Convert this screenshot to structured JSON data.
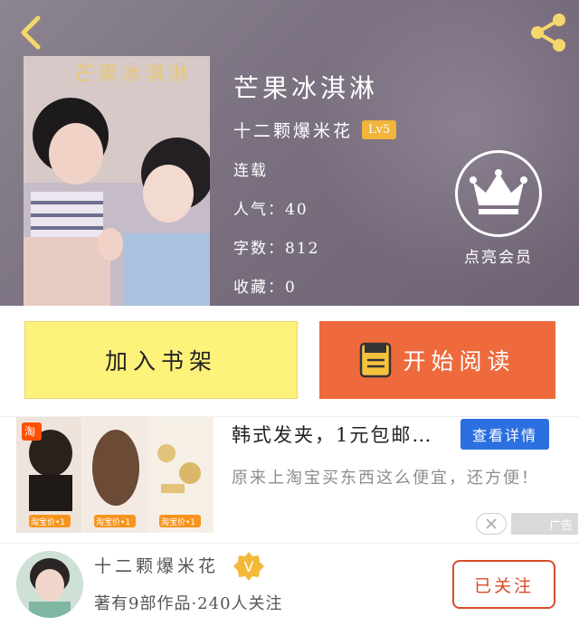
{
  "book": {
    "cover_title": "芒果冰淇淋",
    "title": "芒果冰淇淋",
    "author": "十二颗爆米花",
    "level": "Lv5",
    "status": "连载",
    "popularity": "人气：40",
    "word_count": "字数：812",
    "favorites": "收藏：0"
  },
  "vip": {
    "label": "点亮会员"
  },
  "actions": {
    "add_shelf": "加入书架",
    "start_read": "开始阅读"
  },
  "ad": {
    "image_badge": "淘",
    "price_tags": [
      "淘宝价•1",
      "淘宝价•1",
      "淘宝价•1"
    ],
    "title": "韩式发夹，1元包邮…",
    "cta": "查看详情",
    "description": "原来上淘宝买东西这么便宜，还方便！",
    "tag": "广告"
  },
  "author_card": {
    "name": "十二颗爆米花",
    "v_badge": "V",
    "stats": "著有9部作品·240人关注",
    "follow": "已关注"
  },
  "colors": {
    "shelf_button": "#fdf27a",
    "read_button": "#ee6a3c",
    "cta": "#2c6fe0",
    "follow": "#d94b2b",
    "level_badge": "#f2b43a"
  }
}
